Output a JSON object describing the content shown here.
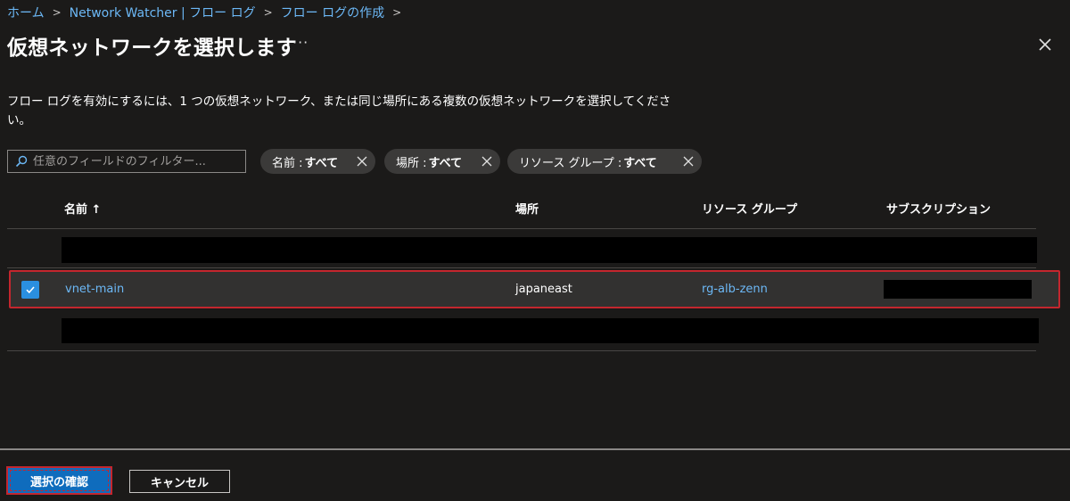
{
  "breadcrumb": {
    "items": [
      "ホーム",
      "Network Watcher | フロー ログ",
      "フロー ログの作成"
    ],
    "separator": ">"
  },
  "header": {
    "title": "仮想ネットワークを選択します",
    "more_label": "···"
  },
  "description": "フロー ログを有効にするには、1 つの仮想ネットワーク、または同じ場所にある複数の仮想ネットワークを選択してください。",
  "filter": {
    "placeholder": "任意のフィールドのフィルター...",
    "value": "",
    "pills": [
      {
        "key": "名前 : ",
        "value": "すべて"
      },
      {
        "key": "場所 : ",
        "value": "すべて"
      },
      {
        "key": "リソース グループ : ",
        "value": "すべて"
      }
    ]
  },
  "table": {
    "columns": [
      "名前 ↑",
      "場所",
      "リソース グループ",
      "サブスクリプション"
    ],
    "selected_row": {
      "name": "vnet-main",
      "location": "japaneast",
      "resource_group": "rg-alb-zenn",
      "checked": true
    }
  },
  "footer": {
    "confirm_label": "選択の確認",
    "cancel_label": "キャンセル"
  },
  "colors": {
    "background": "#1b1a19",
    "link": "#6cb8f6",
    "primary": "#0f6cbd",
    "highlight": "#c4262e",
    "checkbox": "#2a8fe0"
  }
}
